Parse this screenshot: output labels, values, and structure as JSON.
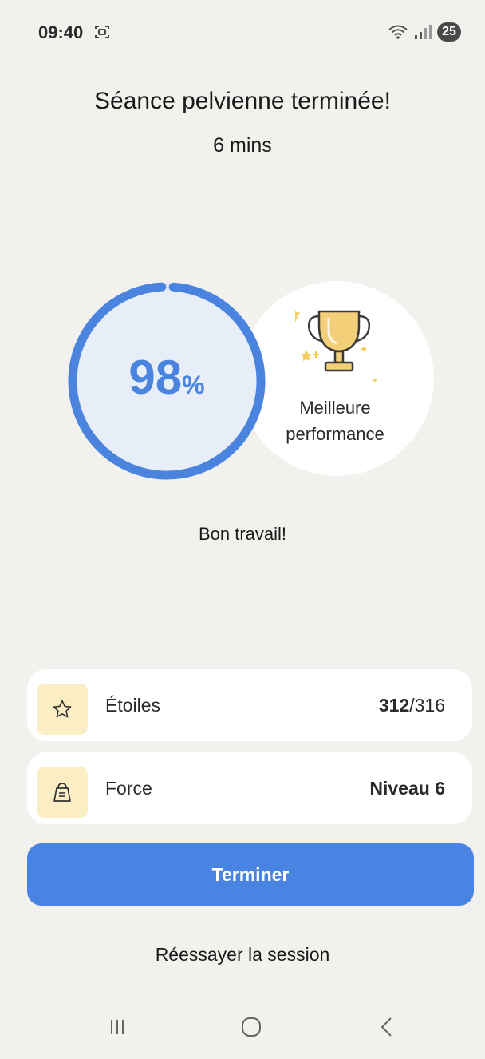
{
  "status_bar": {
    "time": "09:40",
    "battery": "25",
    "icons": [
      "screenshot-icon",
      "wifi-icon",
      "signal-icon"
    ]
  },
  "header": {
    "title": "Séance pelvienne terminée!",
    "duration": "6 mins"
  },
  "score": {
    "value": "98",
    "unit": "%",
    "progress_percent": 98,
    "ring_color": "#4a84df",
    "ring_fill": "#e8eef8"
  },
  "achievement": {
    "icon": "trophy-icon",
    "line1": "Meilleure",
    "line2": "performance"
  },
  "message": "Bon travail!",
  "stats": [
    {
      "icon": "star-icon",
      "label": "Étoiles",
      "value_bold": "312",
      "value_rest": "/316"
    },
    {
      "icon": "kettlebell-icon",
      "label": "Force",
      "value_bold": "Niveau 6",
      "value_rest": ""
    }
  ],
  "actions": {
    "primary": "Terminer",
    "secondary": "Réessayer la session"
  },
  "nav": [
    "recent-apps-icon",
    "home-icon",
    "back-icon"
  ],
  "colors": {
    "background": "#f3f1ed",
    "accent": "#4a84e2",
    "icon_box": "#fbeec4",
    "trophy": "#f3cf7a"
  }
}
